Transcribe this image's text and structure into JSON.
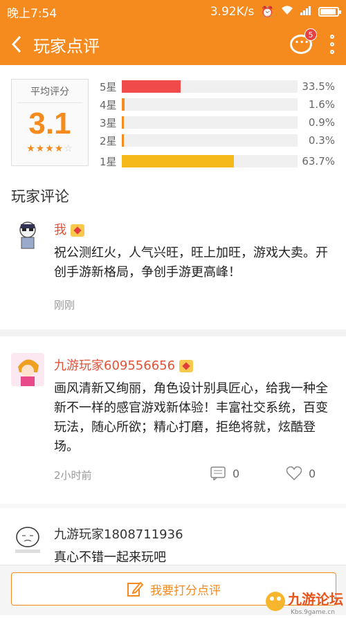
{
  "status": {
    "time": "晚上7:54",
    "speed": "3.92K/s"
  },
  "header": {
    "title": "玩家点评",
    "badge_count": "5"
  },
  "rating": {
    "avg_label": "平均评分",
    "avg_score": "3.1",
    "stars_filled": 3.5,
    "bars": [
      {
        "label": "5星",
        "pct": "33.5%",
        "value": 0.335,
        "color": "#f04a4a"
      },
      {
        "label": "4星",
        "pct": "1.6%",
        "value": 0.016,
        "color": "#f58a1f"
      },
      {
        "label": "3星",
        "pct": "0.9%",
        "value": 0.009,
        "color": "#f58a1f"
      },
      {
        "label": "2星",
        "pct": "0.3%",
        "value": 0.003,
        "color": "#f58a1f"
      },
      {
        "label": "1星",
        "pct": "63.7%",
        "value": 0.637,
        "color": "#f5b91c"
      }
    ]
  },
  "comments_title": "玩家评论",
  "comments": [
    {
      "name": "我",
      "name_color": "#e0523a",
      "text": "祝公测红火，人气兴旺，旺上加旺，游戏大卖。开创手游新格局，争创手游更高峰！",
      "time": "刚刚"
    },
    {
      "name": "九游玩家609556656",
      "name_color": "#e0523a",
      "text": "画风清新又绚丽，角色设计别具匠心，给我一种全新不一样的感官游戏新体验！丰富社交系统，百变玩法，随心所欲；精心打磨，拒绝将就，炫酷登场。",
      "time": "2小时前",
      "comments_count": "0",
      "likes_count": "0"
    },
    {
      "name": "九游玩家1808711936",
      "name_color": "#333333",
      "text": "真心不错一起来玩吧"
    }
  ],
  "bottom": {
    "rate_label": "我要打分点评"
  },
  "watermark": {
    "text": "九游论坛",
    "sub": "Kbs.9game.cn"
  }
}
